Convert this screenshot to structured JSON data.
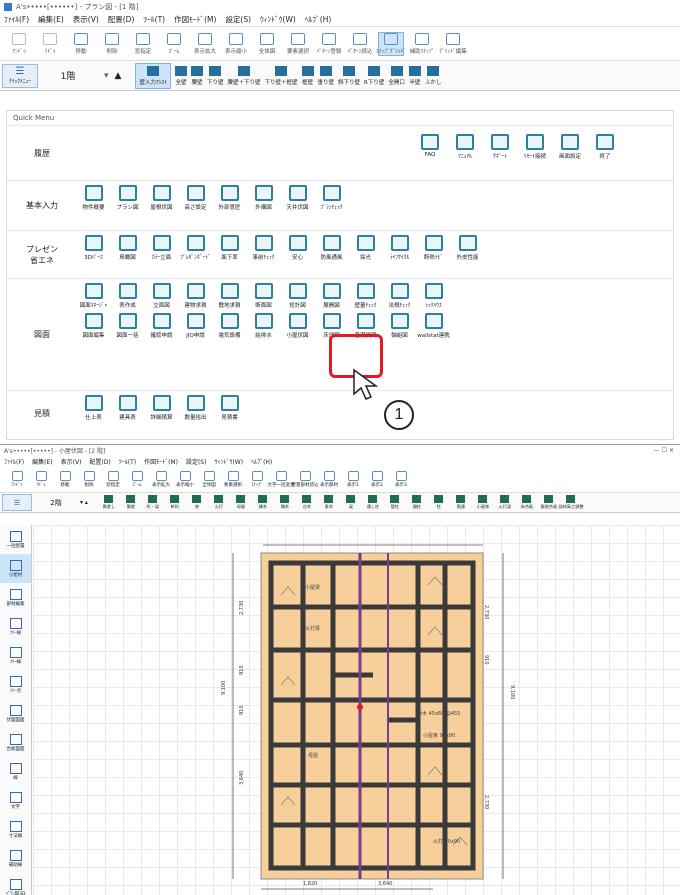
{
  "win1": {
    "title": "A's•••••[••••••] - プラン図 - [1 階]",
    "menu": [
      "ﾌｧｲﾙ(F)",
      "編集(E)",
      "表示(V)",
      "配置(D)",
      "ﾂｰﾙ(T)",
      "作図ﾓｰﾄﾞ(M)",
      "設定(S)",
      "ｳｨﾝﾄﾞｳ(W)",
      "ﾍﾙﾌﾟ(H)"
    ],
    "toolbar": [
      "ｱﾝﾄﾞｩ",
      "ﾘﾄﾞｩ",
      "移動",
      "削除",
      "窓指定",
      "ｽﾞｰﾑ",
      "表示拡大",
      "表示縮小",
      "全体図",
      "要素選択",
      "ﾊﾟﾀｰﾝ登録",
      "ﾊﾟﾀｰﾝ読込",
      "ｽﾅｯﾌﾟｸﾞﾘｯﾄﾞ",
      "補助ｽﾅｯﾌﾟ",
      "ｸﾞﾘｯﾄﾞ編集"
    ],
    "quick_label": "ｸｲｯｸﾒﾆｭｰ",
    "floor": "1階",
    "walls": [
      "壁入力ｱｼｽﾄ",
      "全壁",
      "腰壁",
      "下り壁",
      "腰壁＋下り壁",
      "下り壁＋框壁",
      "框壁",
      "垂り壁",
      "斜下り壁",
      "R下り壁",
      "全開口",
      "半壁",
      "ふかし"
    ]
  },
  "quick_menu": {
    "title": "Quick Menu",
    "rows": [
      {
        "label": "履歴",
        "items": []
      },
      {
        "label": "基本入力",
        "items": [
          "物件概要",
          "プラン図",
          "屋根伏図",
          "高さ設定",
          "外部意匠",
          "外構図",
          "天井伏図",
          "ﾌﾟﾗﾝﾁｪｯｸ"
        ]
      },
      {
        "label": "プレゼン\n省エネ",
        "items": [
          "3Dﾊﾟｰｽ",
          "鳥瞰図",
          "ｶﾗｰ立面",
          "ﾌﾟﾚｾﾞﾝﾎﾞｰﾄﾞ",
          "面下率",
          "事前ﾁｪｯｸ",
          "安心",
          "防風通風",
          "採光",
          "ﾗｲﾌｻｲｸﾙ",
          "断熱ﾅﾋﾞ",
          "外皮性能"
        ]
      },
      {
        "label": "図面",
        "items": [
          "図面ﾏﾈｰｼﾞｬ",
          "表作成",
          "立面図",
          "建物求積",
          "敷地求積",
          "断面図",
          "矩計図",
          "展開図",
          "壁量ﾁｪｯｸ",
          "法規ﾁｪｯｸ",
          "ｼｯｸﾊｳｽ",
          "図面編集",
          "図面一括",
          "確認申請",
          "JIO申請",
          "電気設備",
          "給排水",
          "小屋伏図",
          "床伏図",
          "基礎伏図",
          "軸組図",
          "wallstat連携"
        ]
      },
      {
        "label": "見積",
        "items": [
          "仕上表",
          "建具表",
          "詳細積算",
          "数量拾出",
          "見積書"
        ]
      }
    ],
    "top_items": [
      "FAQ",
      "ﾏﾆｭｱﾙ",
      "ｻﾎﾟｰﾄ",
      "ﾘﾓｰﾄ接続",
      "画面設定",
      "終了"
    ],
    "callout": "1"
  },
  "win2": {
    "title": "A's•••••[•••••] - 小屋伏図 - [2 階]",
    "controls": "—   ☐   ✕",
    "menu": [
      "ﾌｧｲﾙ(F)",
      "編集(E)",
      "表示(V)",
      "配置(D)",
      "ﾂｰﾙ(T)",
      "作図ﾓｰﾄﾞ(M)",
      "設定(S)",
      "ｳｨﾝﾄﾞｳ(W)",
      "ﾍﾙﾌﾟ(H)"
    ],
    "toolbar": [
      "ｱﾝﾄﾞｩ",
      "ﾘﾄﾞｩ",
      "移動",
      "削除",
      "窓指定",
      "ｽﾞｰﾑ",
      "表示拡大",
      "表示縮小",
      "全体図",
      "要素選択",
      "ｽﾅｯﾌﾟ",
      "文字一括変更",
      "壁量部材読込",
      "表示部材",
      "表示1",
      "表示2",
      "表示3"
    ],
    "floor": "2階",
    "bar": [
      "異差し",
      "胴差",
      "桁・梁",
      "軒桁",
      "束",
      "火打",
      "母屋",
      "棟木",
      "隅木",
      "谷木",
      "垂木",
      "梁",
      "通し柱",
      "管柱",
      "間柱",
      "柱",
      "筋違",
      "小屋束",
      "火打梁",
      "床合板",
      "屋根合板",
      "部材高さ調整"
    ],
    "side": [
      "一括配置",
      "小屋材",
      "部材編集",
      "ﾌﾘｰ線",
      "ﾌﾘｰ線",
      "ﾌﾘｰ点",
      "伏図図面",
      "合板図面",
      "線",
      "文字",
      "寸法線",
      "補助線",
      "ﾌﾟﾗﾝ図3D"
    ],
    "dims": {
      "top1": "2,730",
      "top2": "910",
      "top3": "2,730",
      "bottom1": "1,820",
      "bottom2": "3,640",
      "left1": "2,730",
      "left2": "910",
      "left3": "910",
      "left4": "3,640",
      "right": "9,100",
      "leftTotal": "9,100"
    },
    "labels": [
      "小屋梁",
      "棟木 45x60 @455",
      "小屋束 90x90",
      "火打梁",
      "母屋",
      "火打 90x90"
    ]
  }
}
